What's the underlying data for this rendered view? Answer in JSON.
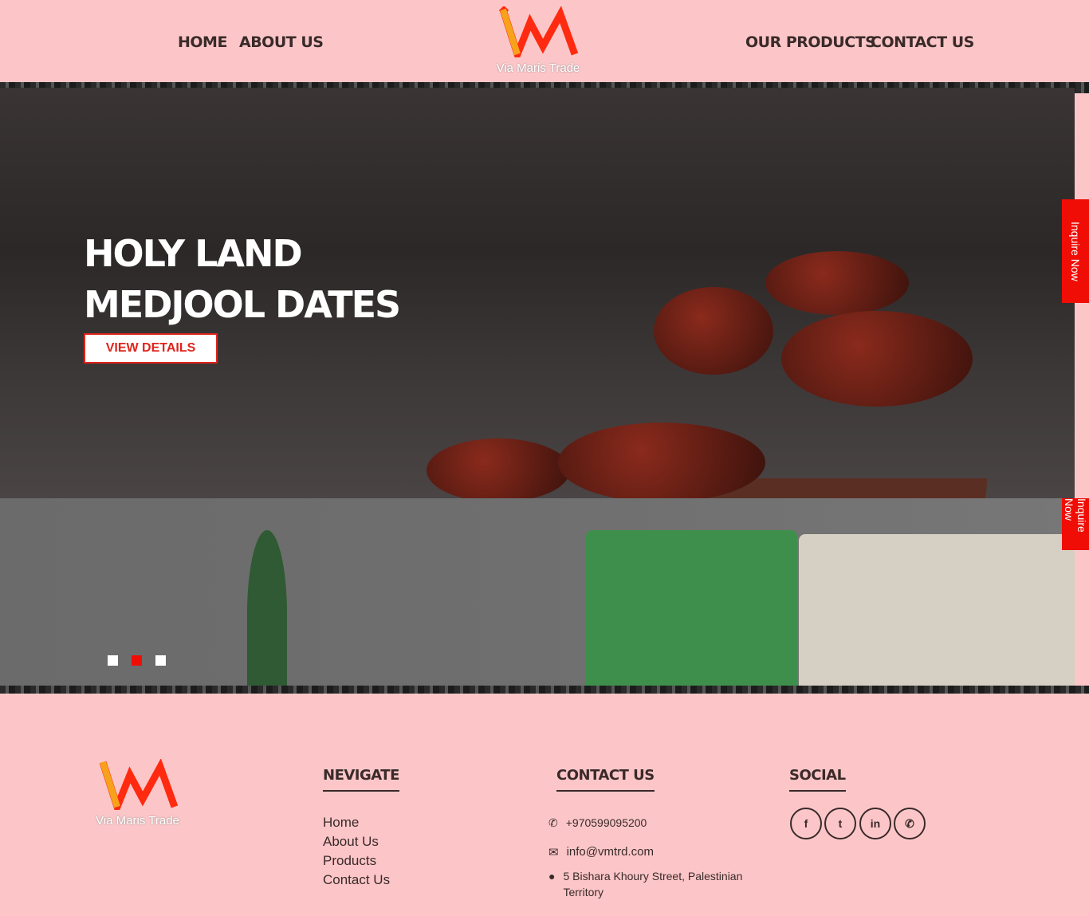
{
  "nav": {
    "home": "HOME",
    "about": "ABOUT US",
    "products": "OUR PRODUCTS",
    "contact": "CONTACT US"
  },
  "logo": {
    "text": "Via Maris Trade"
  },
  "hero": {
    "title_line1": "HOLY LAND",
    "title_line2": "MEDJOOL DATES",
    "button": "VIEW DETAILS",
    "inquire": "Inquire Now",
    "active_slide": 2,
    "slide_count": 3
  },
  "footer": {
    "navigate": {
      "heading": "NEVIGATE",
      "links": [
        "Home",
        "About Us",
        "Products",
        "Contact Us"
      ]
    },
    "contact": {
      "heading": "CONTACT US",
      "phone": "+970599095200",
      "email": "info@vmtrd.com",
      "address_line1": "5 Bishara Khoury Street, Palestinian",
      "address_line2": "Territory"
    },
    "social": {
      "heading": "SOCIAL",
      "icons": [
        "facebook-icon",
        "twitter-icon",
        "linkedin-icon",
        "whatsapp-icon"
      ]
    }
  },
  "colors": {
    "background": "#fcc6c8",
    "accent": "#e0241b",
    "text": "#3a2a2a"
  }
}
